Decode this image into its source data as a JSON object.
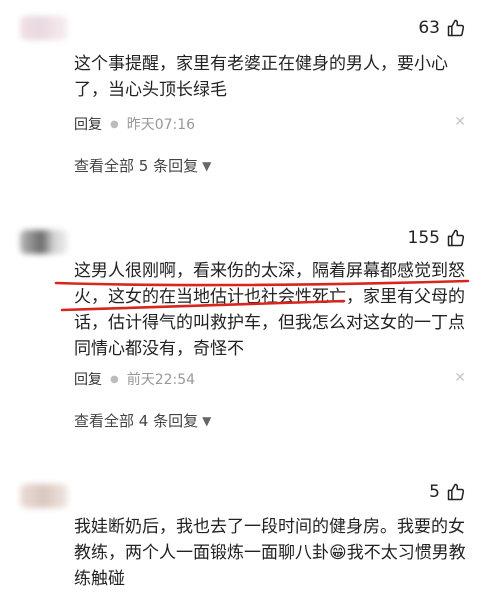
{
  "comments": [
    {
      "likes": "63",
      "lines": [
        "这个事提醒，家里有老婆正在健身的男人，要小心",
        "了，当心头顶长绿毛"
      ],
      "reply_label": "回复",
      "time": "昨天07:16",
      "more_label": "查看全部 5 条回复"
    },
    {
      "likes": "155",
      "lines": [
        "这男人很刚啊，看来伤的太深，隔着屏幕都感觉到怒",
        "火，这女的在当地估计也社会性死亡，家里有父母的",
        "话，估计得气的叫救护车，但我怎么对这女的一丁点",
        "同情心都没有，奇怪不"
      ],
      "reply_label": "回复",
      "time": "前天22:54",
      "more_label": "查看全部 4 条回复"
    },
    {
      "likes": "5",
      "lines": [
        "我娃断奶后，我也去了一段时间的健身房。我要的女",
        "教练，两个人一面锻炼一面聊八卦😁我不太习惯男教",
        "练触碰"
      ]
    }
  ],
  "icons": {
    "like": "thumbs-up-outline",
    "close": "x-mark",
    "expand": "chevron-down"
  },
  "colors": {
    "annotation": "#d9261c",
    "muted": "#999999"
  }
}
